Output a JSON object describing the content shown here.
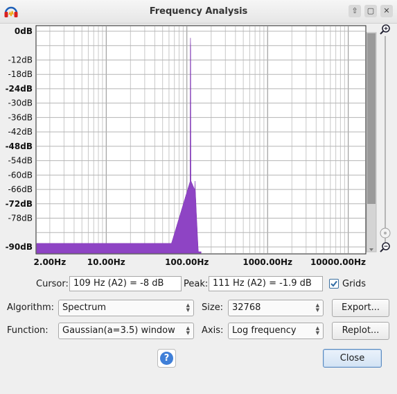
{
  "window": {
    "title": "Frequency Analysis",
    "app_icon": "headphones-icon"
  },
  "window_controls": [
    {
      "name": "minimize-button",
      "symbol": "⇧"
    },
    {
      "name": "maximize-button",
      "symbol": "▢"
    },
    {
      "name": "close-button",
      "symbol": "✕"
    }
  ],
  "plot": {
    "y_labels": [
      {
        "text": "0dB",
        "db": 0,
        "bold": true
      },
      {
        "text": "-12dB",
        "db": -12,
        "bold": false
      },
      {
        "text": "-18dB",
        "db": -18,
        "bold": false
      },
      {
        "text": "-24dB",
        "db": -24,
        "bold": true
      },
      {
        "text": "-30dB",
        "db": -30,
        "bold": false
      },
      {
        "text": "-36dB",
        "db": -36,
        "bold": false
      },
      {
        "text": "-42dB",
        "db": -42,
        "bold": false
      },
      {
        "text": "-48dB",
        "db": -48,
        "bold": true
      },
      {
        "text": "-54dB",
        "db": -54,
        "bold": false
      },
      {
        "text": "-60dB",
        "db": -60,
        "bold": false
      },
      {
        "text": "-66dB",
        "db": -66,
        "bold": false
      },
      {
        "text": "-72dB",
        "db": -72,
        "bold": true
      },
      {
        "text": "-78dB",
        "db": -78,
        "bold": false
      },
      {
        "text": "-90dB",
        "db": -90,
        "bold": true
      }
    ],
    "x_labels": [
      {
        "text": "2.00Hz",
        "hz": 2
      },
      {
        "text": "10.00Hz",
        "hz": 10
      },
      {
        "text": "100.00Hz",
        "hz": 100
      },
      {
        "text": "1000.00Hz",
        "hz": 1000
      },
      {
        "text": "10000.00Hz",
        "hz": 10000
      }
    ],
    "x_range_hz": [
      1.35,
      16500
    ],
    "y_range_db": [
      -90,
      0
    ],
    "x_scale": "log",
    "grid": true,
    "spectrum_color": "#8e44c4",
    "peak_hz": 111,
    "peak_db": -1.9,
    "noise_floor_db": -88.5,
    "zoom_in_icon": "zoom-in-icon",
    "zoom_out_icon": "zoom-out-icon",
    "zoom_thumb_icon": "slider-thumb-icon"
  },
  "cursor": {
    "label": "Cursor:",
    "value": "109 Hz (A2) = -8 dB"
  },
  "peak": {
    "label": "Peak:",
    "value": "111 Hz (A2) = -1.9 dB"
  },
  "grids": {
    "label": "Grids",
    "checked": true
  },
  "algorithm": {
    "label": "Algorithm:",
    "value": "Spectrum"
  },
  "size": {
    "label": "Size:",
    "value": "32768"
  },
  "function": {
    "label": "Function:",
    "value": "Gaussian(a=3.5) window"
  },
  "axis": {
    "label": "Axis:",
    "value": "Log frequency"
  },
  "buttons": {
    "export": "Export...",
    "replot": "Replot...",
    "help": "?",
    "close": "Close"
  }
}
